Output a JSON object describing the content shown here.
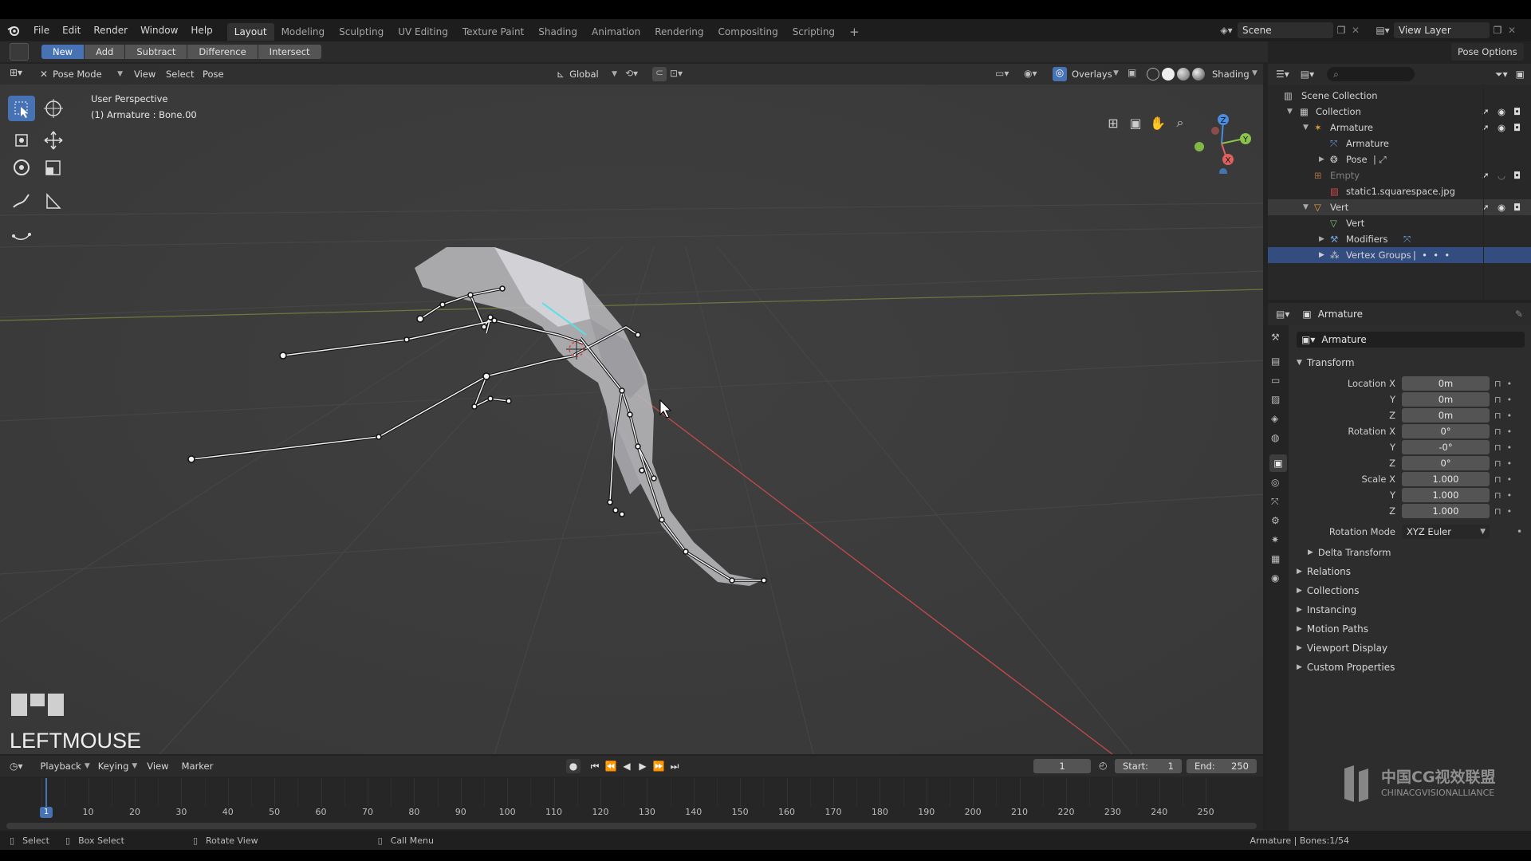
{
  "menu": [
    "File",
    "Edit",
    "Render",
    "Window",
    "Help"
  ],
  "workspaces": [
    "Layout",
    "Modeling",
    "Sculpting",
    "UV Editing",
    "Texture Paint",
    "Shading",
    "Animation",
    "Rendering",
    "Compositing",
    "Scripting"
  ],
  "active_workspace": "Layout",
  "add_workspace": "+",
  "scene": {
    "label": "Scene",
    "view_layer": "View Layer"
  },
  "tool_modes": [
    "New",
    "Add",
    "Subtract",
    "Difference",
    "Intersect"
  ],
  "pose_options": "Pose Options",
  "viewport": {
    "mode": "Pose Mode",
    "menus": [
      "View",
      "Select",
      "Pose"
    ],
    "orientation": "Global",
    "overlays": "Overlays",
    "shading": "Shading",
    "info_line1": "User Perspective",
    "info_line2": "(1) Armature : Bone.00",
    "gizmo_z": "Z",
    "gizmo_y": "Y",
    "gizmo_x": "X",
    "keypress": "LEFTMOUSE"
  },
  "outliner": {
    "rows": [
      {
        "label": "Scene Collection",
        "indent": 0
      },
      {
        "label": "Collection",
        "indent": 1
      },
      {
        "label": "Armature",
        "indent": 2
      },
      {
        "label": "Armature",
        "indent": 3
      },
      {
        "label": "Pose",
        "indent": 3
      },
      {
        "label": "Empty",
        "indent": 2
      },
      {
        "label": "static1.squarespace.jpg",
        "indent": 3
      },
      {
        "label": "Vert",
        "indent": 2
      },
      {
        "label": "Vert",
        "indent": 3
      },
      {
        "label": "Modifiers",
        "indent": 3
      },
      {
        "label": "Vertex Groups",
        "indent": 3
      }
    ]
  },
  "properties": {
    "header": "Armature",
    "object_name": "Armature",
    "transform_title": "Transform",
    "location_label": "Location X",
    "rotation_label": "Rotation X",
    "scale_label": "Scale X",
    "axis_y": "Y",
    "axis_z": "Z",
    "location": [
      "0m",
      "0m",
      "0m"
    ],
    "rotation": [
      "0°",
      "-0°",
      "0°"
    ],
    "scale": [
      "1.000",
      "1.000",
      "1.000"
    ],
    "rotation_mode_label": "Rotation Mode",
    "rotation_mode": "XYZ Euler",
    "delta": "Delta Transform",
    "panels": [
      "Relations",
      "Collections",
      "Instancing",
      "Motion Paths",
      "Viewport Display",
      "Custom Properties"
    ]
  },
  "timeline": {
    "menus": [
      "Playback",
      "Keying",
      "View",
      "Marker"
    ],
    "current_frame": "1",
    "start_label": "Start:",
    "start": "1",
    "end_label": "End:",
    "end": "250",
    "frame_marker": "1",
    "ticks": [
      "10",
      "20",
      "30",
      "40",
      "50",
      "60",
      "70",
      "80",
      "90",
      "100",
      "110",
      "120",
      "130",
      "140",
      "150",
      "160",
      "170",
      "180",
      "190",
      "200",
      "210",
      "220",
      "230",
      "240",
      "250"
    ]
  },
  "status": {
    "select": "Select",
    "box_select": "Box Select",
    "rotate_view": "Rotate View",
    "call_menu": "Call Menu",
    "right_info": "Armature | Bones:1/54"
  },
  "watermark": {
    "line1": "中国CG视效联盟",
    "line2": "CHINACGVISIONALLIANCE"
  },
  "colors": {
    "accent": "#4772b3",
    "x_axis": "#e06060",
    "y_axis": "#8ac44a",
    "z_axis": "#4a8ce0"
  }
}
